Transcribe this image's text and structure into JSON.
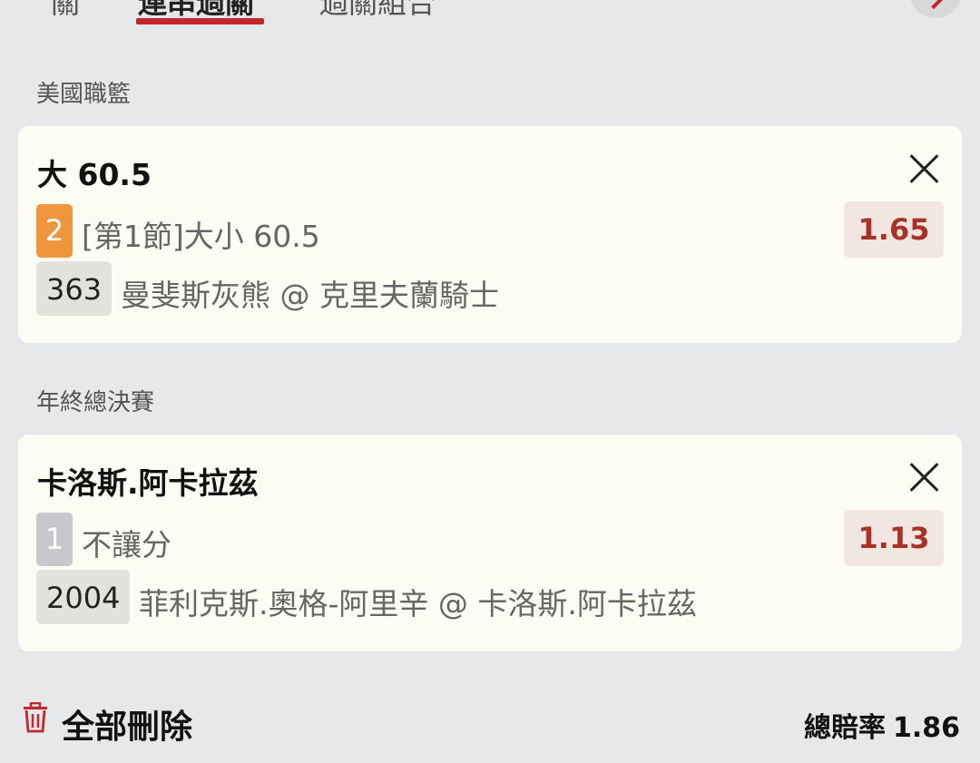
{
  "tabs": [
    {
      "label": "關"
    },
    {
      "label": "連串過關"
    },
    {
      "label": "過關組合"
    }
  ],
  "sections": [
    {
      "title": "美國職籃",
      "bet": {
        "selection": "大 60.5",
        "badge": "2",
        "badge_color": "#f0963c",
        "description": "[第1節]大小 60.5",
        "odds": "1.65",
        "match_id": "363",
        "match": "曼斐斯灰熊 @ 克里夫蘭騎士"
      }
    },
    {
      "title": "年終總決賽",
      "bet": {
        "selection": "卡洛斯.阿卡拉茲",
        "badge": "1",
        "badge_color": "#c8c8cc",
        "description": "不讓分",
        "odds": "1.13",
        "match_id": "2004",
        "match": "菲利克斯.奧格-阿里辛 @ 卡洛斯.阿卡拉茲"
      }
    }
  ],
  "footer": {
    "delete_all_label": "全部刪除",
    "total_odds_label": "總賠率",
    "total_odds_value": "1.86"
  },
  "colors": {
    "accent_red": "#c0282d",
    "odds_text": "#a93226",
    "card_bg": "#fcfcf5",
    "page_bg": "#e7e8ea"
  },
  "icons": [
    "chevron-right-icon",
    "close-icon",
    "trash-icon"
  ]
}
